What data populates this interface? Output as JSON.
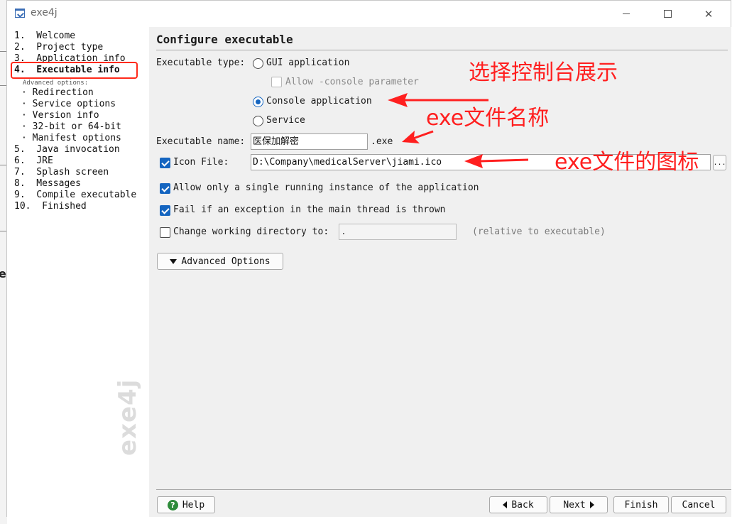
{
  "window": {
    "title": "exe4j"
  },
  "nav": {
    "items": [
      {
        "label": "1.  Welcome"
      },
      {
        "label": "2.  Project type"
      },
      {
        "label": "3.  Application info"
      },
      {
        "label": "4.  Executable info"
      },
      {
        "label": "Advanced options:"
      },
      {
        "label": "· Redirection"
      },
      {
        "label": "· Service options"
      },
      {
        "label": "· Version info"
      },
      {
        "label": "· 32-bit or 64-bit"
      },
      {
        "label": "· Manifest options"
      },
      {
        "label": "5.  Java invocation"
      },
      {
        "label": "6.  JRE"
      },
      {
        "label": "7.  Splash screen"
      },
      {
        "label": "8.  Messages"
      },
      {
        "label": "9.  Compile executable"
      },
      {
        "label": "10.  Finished"
      }
    ],
    "active_index": 3,
    "brand": "exe4j"
  },
  "main": {
    "title": "Configure executable",
    "exe_type_label": "Executable type:",
    "gui_option": "GUI application",
    "allow_console": "Allow -console parameter",
    "console_option": "Console application",
    "service_option": "Service",
    "selected_type": "console",
    "exe_name_label": "Executable name:",
    "exe_name_value": "医保加解密",
    "exe_suffix": ".exe",
    "icon_file_label": "Icon File:",
    "icon_file_checked": true,
    "icon_file_value": "D:\\Company\\medicalServer\\jiami.ico",
    "browse_label": "...",
    "single_instance_label": "Allow only a single running instance of the application",
    "single_instance_checked": true,
    "fail_exception_label": "Fail if an exception in the main thread is thrown",
    "fail_exception_checked": true,
    "change_dir_label": "Change working directory to:",
    "change_dir_checked": false,
    "change_dir_value": ".",
    "change_dir_note": "(relative to executable)",
    "advanced_button": "Advanced Options"
  },
  "footer": {
    "help": "Help",
    "back": "Back",
    "next": "Next",
    "finish": "Finish",
    "cancel": "Cancel"
  },
  "annotations": {
    "console": "选择控制台展示",
    "exe_name": "exe文件名称",
    "icon": "exe文件的图标",
    "color": "#ff1f1f"
  }
}
